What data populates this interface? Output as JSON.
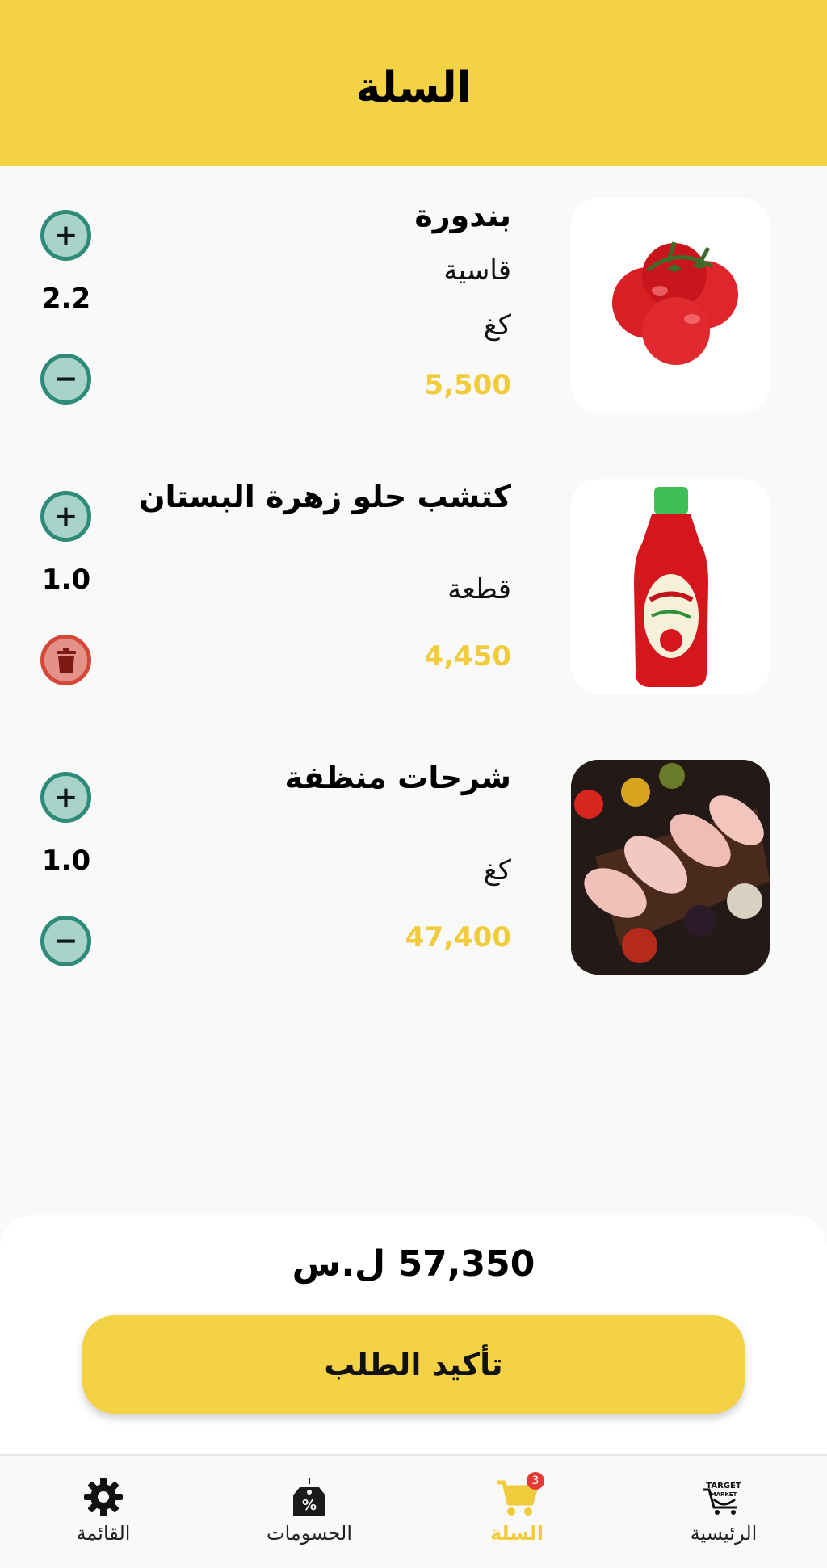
{
  "header": {
    "title": "السلة"
  },
  "cart_items": [
    {
      "name": "بندورة",
      "variant": "قاسية",
      "unit": "كغ",
      "price": "5,500",
      "quantity": "2.2",
      "image": "tomatoes-image",
      "decrement_kind": "minus"
    },
    {
      "name": "كتشب حلو زهرة البستان",
      "unit": "قطعة",
      "price": "4,450",
      "quantity": "1.0",
      "image": "ketchup-bottle-image",
      "decrement_kind": "delete"
    },
    {
      "name": "شرحات منظفة",
      "unit": "كغ",
      "price": "47,400",
      "quantity": "1.0",
      "image": "chicken-breast-image",
      "decrement_kind": "minus"
    }
  ],
  "summary": {
    "total": "57,350 ل.س",
    "confirm_label": "تأكيد الطلب"
  },
  "bottom_nav": {
    "items": [
      {
        "label": "القائمة",
        "icon": "gear-icon",
        "active": false
      },
      {
        "label": "الحسومات",
        "icon": "discount-tag-icon",
        "active": false
      },
      {
        "label": "السلة",
        "icon": "cart-icon",
        "active": true,
        "badge": "3"
      },
      {
        "label": "الرئيسية",
        "icon": "target-market-logo-icon",
        "active": false
      }
    ]
  },
  "colors": {
    "brand_yellow": "#f3d246",
    "price_yellow": "#f0cc3c",
    "qty_green": "#2e8b79",
    "delete_red": "#d4473b",
    "badge_red": "#e53935"
  }
}
